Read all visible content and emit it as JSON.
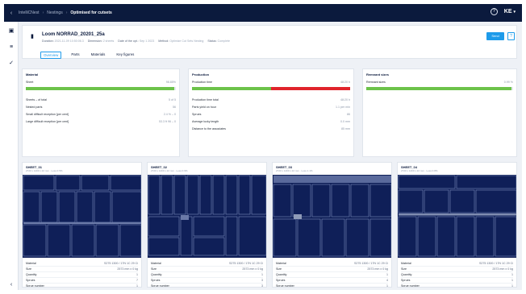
{
  "topbar": {
    "breadcrumbs": [
      "IntelliCNest",
      "Nestings",
      "Optimised for cutsets"
    ],
    "user_initials": "KE"
  },
  "header": {
    "title": "Loom NORRAD_20201_25a",
    "meta": [
      {
        "label": "Duration",
        "value": "2021-11-09 10:50:06.3"
      },
      {
        "label": "Dimension",
        "value": "2 sheets"
      },
      {
        "label": "Date of the opt.",
        "value": "Sep 1 2023"
      },
      {
        "label": "Method",
        "value": "Optimize Cut Sets Nesting"
      },
      {
        "label": "Status",
        "value": "Complete"
      }
    ],
    "primary_button": "Send",
    "help_button": "?"
  },
  "tabs": [
    "Overview",
    "Parts",
    "Materials",
    "Key figures"
  ],
  "panels": {
    "panel1": {
      "title": "Material",
      "bar_label": "Sheet",
      "bar_value": "98.85%",
      "bar_fill": 0.99,
      "rows": [
        {
          "label": "Sheets  –  of total",
          "value": "5 of 5"
        },
        {
          "label": "Nested parts",
          "value": "56"
        },
        {
          "label": "Small difficult reception [per cent]",
          "value": "2.4 %  – 0"
        },
        {
          "label": "Large difficult reception [per cent]",
          "value": "53.3 ft 96 – 0"
        }
      ]
    },
    "panel2": {
      "title": "Production",
      "bar_label": "Production time",
      "bar_value": "48:20 h",
      "bar_fill_green": 0.5,
      "bar_fill_red": 0.5,
      "rows": [
        {
          "label": "Production time total",
          "value": "48:20 h"
        },
        {
          "label": "Parts yield on hour",
          "value": "1.1 per min"
        },
        {
          "label": "Sprues",
          "value": "86"
        },
        {
          "label": "Average lucky length",
          "value": "0.0 mm"
        },
        {
          "label": "Distance to the associates",
          "value": "85 mm"
        }
      ]
    },
    "panel3": {
      "title": "Remnant sizes",
      "bar_label": "Remnant sizes",
      "bar_value": "0.99 %",
      "bar_fill": 0.99
    }
  },
  "cards": [
    {
      "name": "SHEET_01",
      "sub": "2720 x 1400 x 22 mm  ·  Loss 0.5%",
      "rows": [
        {
          "label": "Material",
          "value": "S275 1300 / 17N  1C 29 Ci"
        },
        {
          "label": "Size",
          "value": "2573 mm x 0 kg"
        },
        {
          "label": "Quantity",
          "value": "1"
        },
        {
          "label": "Sprues",
          "value": "7"
        },
        {
          "label": "Sprue number",
          "value": "1"
        }
      ]
    },
    {
      "name": "SHEET_02",
      "sub": "2720 x 1400 x 22 mm  ·  Loss 0.9%",
      "rows": [
        {
          "label": "Material",
          "value": "S275 1300 / 17N  1C 29 Ci"
        },
        {
          "label": "Size",
          "value": "2573 mm x 0 kg"
        },
        {
          "label": "Quantity",
          "value": "1"
        },
        {
          "label": "Sprues",
          "value": "3"
        },
        {
          "label": "Sprue number",
          "value": "3"
        }
      ]
    },
    {
      "name": "SHEET_03",
      "sub": "2720 x 1400 x 22 mm  ·  Loss 1.1%",
      "rows": [
        {
          "label": "Material",
          "value": "S275 1300 / 17N  1C 29 Ci"
        },
        {
          "label": "Size",
          "value": "2573 mm x 0 kg"
        },
        {
          "label": "Quantity",
          "value": "1"
        },
        {
          "label": "Sprues",
          "value": "4"
        },
        {
          "label": "Sprue number",
          "value": "1"
        }
      ]
    },
    {
      "name": "SHEET_04",
      "sub": "2720 x 1400 x 22 mm  ·  Loss 0.8%",
      "rows": [
        {
          "label": "Material",
          "value": "S275 1300 / 17N  1C 29 Ci"
        },
        {
          "label": "Size",
          "value": "2573 mm x 0 kg"
        },
        {
          "label": "Quantity",
          "value": "1"
        },
        {
          "label": "Sprues",
          "value": "1"
        },
        {
          "label": "Sprue number",
          "value": "1"
        }
      ]
    }
  ],
  "colors": {
    "accent": "#1e9bea",
    "navy": "#0b1a3d",
    "sheet": "#0f1f58",
    "green": "#6cc24a",
    "red": "#e0242c"
  },
  "icons": [
    "back-arrow-icon",
    "help-icon",
    "document-icon",
    "nest-icon",
    "list-icon",
    "check-icon",
    "collapse-icon"
  ]
}
